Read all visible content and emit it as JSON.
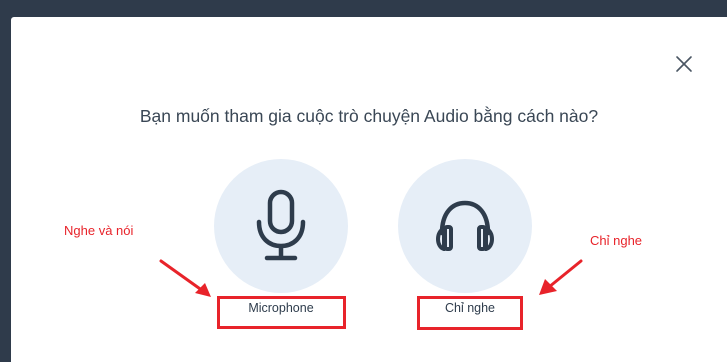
{
  "dialog": {
    "prompt": "Bạn muốn tham gia cuộc trò chuyện Audio bằng cách nào?",
    "close_icon": "close-icon"
  },
  "options": {
    "microphone": {
      "label": "Microphone",
      "icon": "microphone-icon"
    },
    "listen_only": {
      "label": "Chỉ nghe",
      "icon": "headphones-icon"
    }
  },
  "annotations": {
    "left_note": "Nghe và nói",
    "right_note": "Chỉ nghe",
    "color": "#e8232a"
  },
  "colors": {
    "backdrop": "#2f3b4b",
    "dialog_bg": "#ffffff",
    "icon_circle_bg": "#e6eef7",
    "icon_stroke": "#2e3c4c",
    "text": "#3a4755"
  }
}
